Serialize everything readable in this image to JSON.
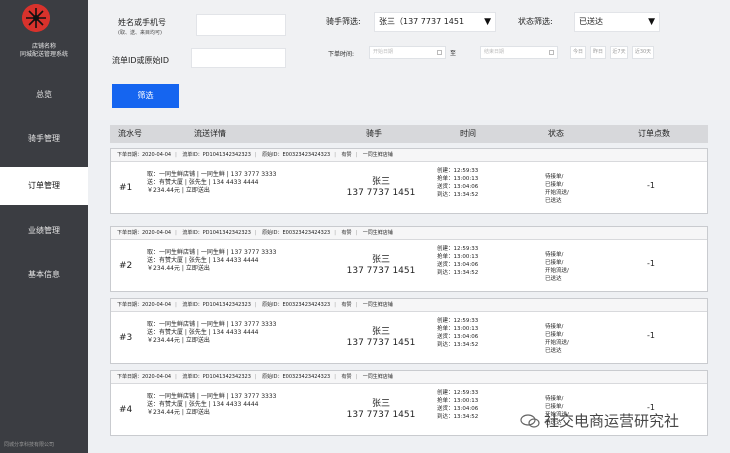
{
  "sidebar": {
    "brand_line1": "店铺名称",
    "brand_line2": "同城配送管理系统",
    "items": [
      {
        "label": "总览"
      },
      {
        "label": "骑手管理"
      },
      {
        "label": "订单管理"
      },
      {
        "label": "业绩管理"
      },
      {
        "label": "基本信息"
      }
    ],
    "active_index": 2,
    "footer": "同城分享科技有限公司"
  },
  "filters": {
    "name_phone_label": "姓名或手机号",
    "name_phone_hint": "(取、送、来目均可)",
    "order_id_label": "流单ID或原始ID",
    "rider_label": "骑手筛选:",
    "rider_value": "张三（137 7737 1451",
    "status_label": "状态筛选:",
    "status_value": "已送达",
    "order_time_label": "下单时间:",
    "start_placeholder": "开始日期",
    "range_sep": "至",
    "end_placeholder": "结束日期",
    "quick_buttons": [
      "今日",
      "昨日",
      "近7天",
      "近30天"
    ],
    "filter_button": "筛选"
  },
  "table": {
    "headers": [
      "流水号",
      "流送详情",
      "骑手",
      "时间",
      "状态",
      "订单点数"
    ],
    "orders": [
      {
        "index": "#1",
        "order_date": "下单日期：2020-04-04",
        "order_id": "流单ID：PD1041342342323",
        "raw_id": "原始ID：E00323423424323",
        "platform": "有赞",
        "shop": "一同生鲜店铺",
        "pickup": "取：一同生鲜店铺 | 一同生鲜 | 137 3777 3333",
        "deliver": "送：有赞大厦 | 张先生 | 134 4433 4444",
        "amount": "￥234.44元 | 立即送出",
        "rider_name": "张三",
        "rider_phone": "137 7737 1451",
        "times": [
          "创建：12:59:33",
          "抢单：13:00:13",
          "送货：13:04:06",
          "到达：13:34:52"
        ],
        "status": [
          "待接单/",
          "已接单/",
          "开始流送/",
          "已送达"
        ],
        "points": "-1"
      },
      {
        "index": "#2",
        "order_date": "下单日期：2020-04-04",
        "order_id": "流单ID：PD1041342342323",
        "raw_id": "原始ID：E00323423424323",
        "platform": "有赞",
        "shop": "一同生鲜店铺",
        "pickup": "取：一同生鲜店铺 | 一同生鲜 | 137 3777 3333",
        "deliver": "送：有赞大厦 | 张先生 | 134 4433 4444",
        "amount": "￥234.44元 | 立即送出",
        "rider_name": "张三",
        "rider_phone": "137 7737 1451",
        "times": [
          "创建：12:59:33",
          "抢单：13:00:13",
          "送货：13:04:06",
          "到达：13:34:52"
        ],
        "status": [
          "待接单/",
          "已接单/",
          "开始流送/",
          "已送达"
        ],
        "points": "-1"
      },
      {
        "index": "#3",
        "order_date": "下单日期：2020-04-04",
        "order_id": "流单ID：PD1041342342323",
        "raw_id": "原始ID：E00323423424323",
        "platform": "有赞",
        "shop": "一同生鲜店铺",
        "pickup": "取：一同生鲜店铺 | 一同生鲜 | 137 3777 3333",
        "deliver": "送：有赞大厦 | 张先生 | 134 4433 4444",
        "amount": "￥234.44元 | 立即送出",
        "rider_name": "张三",
        "rider_phone": "137 7737 1451",
        "times": [
          "创建：12:59:33",
          "抢单：13:00:13",
          "送货：13:04:06",
          "到达：13:34:52"
        ],
        "status": [
          "待接单/",
          "已接单/",
          "开始流送/",
          "已送达"
        ],
        "points": "-1"
      },
      {
        "index": "#4",
        "order_date": "下单日期：2020-04-04",
        "order_id": "流单ID：PD1041342342323",
        "raw_id": "原始ID：E00323423424323",
        "platform": "有赞",
        "shop": "一同生鲜店铺",
        "pickup": "取：一同生鲜店铺 | 一同生鲜 | 137 3777 3333",
        "deliver": "送：有赞大厦 | 张先生 | 134 4433 4444",
        "amount": "￥234.44元 | 立即送出",
        "rider_name": "张三",
        "rider_phone": "137 7737 1451",
        "times": [
          "创建：12:59:33",
          "抢单：13:00:13",
          "送货：13:04:06",
          "到达：13:34:52"
        ],
        "status": [
          "待接单/",
          "已接单/",
          "开始流送/",
          "已送达"
        ],
        "points": "-1"
      }
    ]
  },
  "watermark": "社交电商运营研究社",
  "colors": {
    "sidebar_bg": "#3b3d42",
    "primary": "#1565f0",
    "logo_red": "#d8322c"
  }
}
